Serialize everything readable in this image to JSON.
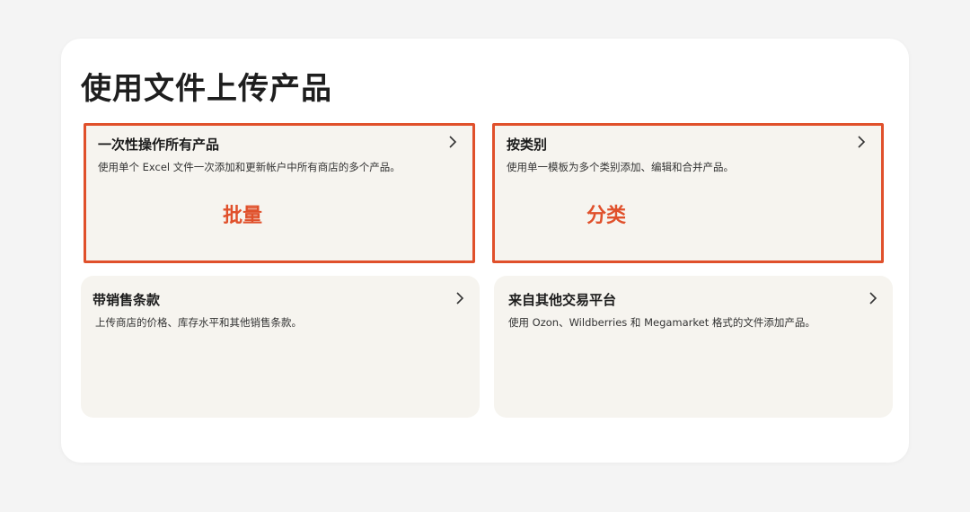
{
  "page": {
    "title": "使用文件上传产品"
  },
  "cards": [
    {
      "title": "一次性操作所有产品",
      "description": "使用单个 Excel 文件一次添加和更新帐户中所有商店的多个产品。",
      "annotation": "批量"
    },
    {
      "title": "按类别",
      "description": "使用单一模板为多个类别添加、编辑和合并产品。",
      "annotation": "分类"
    },
    {
      "title": "带销售条款",
      "description": "上传商店的价格、库存水平和其他销售条款。"
    },
    {
      "title": "来自其他交易平台",
      "description": "使用 Ozon、Wildberries 和 Megamarket 格式的文件添加产品。"
    }
  ],
  "colors": {
    "highlight": "#e0502b",
    "card_bg": "#f6f4ef"
  },
  "icons": {
    "chevron": "chevron-right-icon"
  }
}
